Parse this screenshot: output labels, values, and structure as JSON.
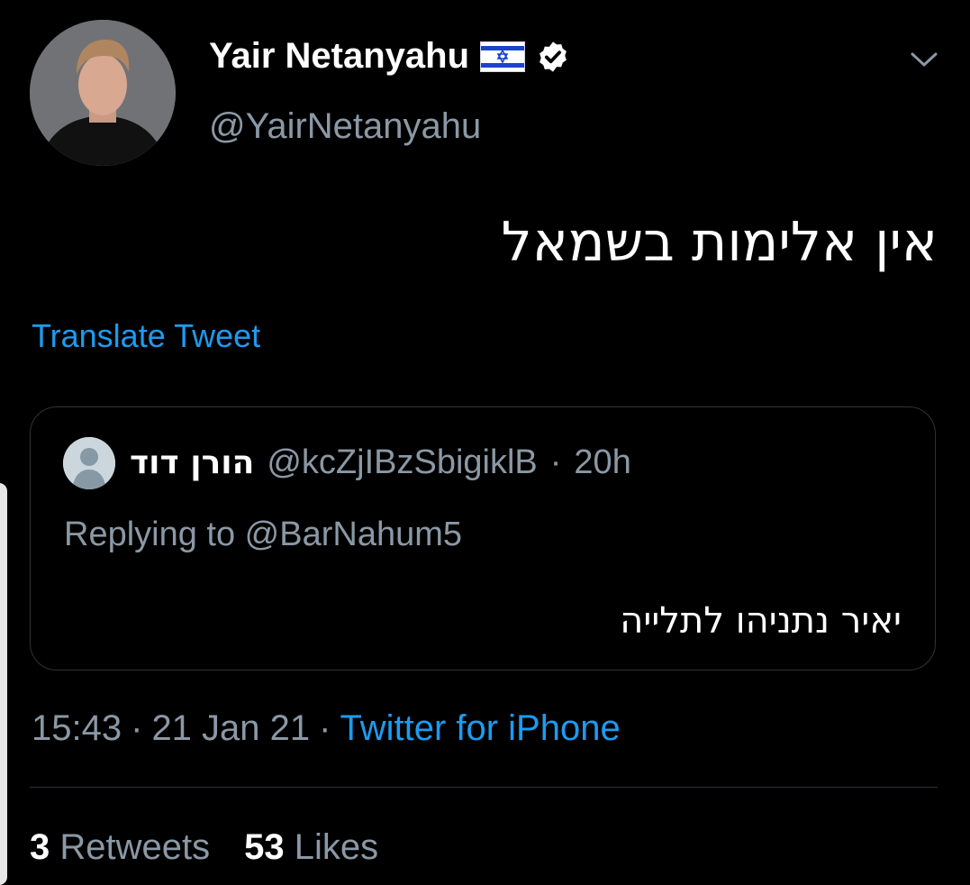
{
  "author": {
    "display_name": "Yair Netanyahu",
    "handle": "@YairNetanyahu",
    "flag_icon": "israel-flag-icon",
    "verified_icon": "verified-badge-icon"
  },
  "tweet": {
    "text": "אין אלימות בשמאל",
    "translate_label": "Translate Tweet"
  },
  "quoted_tweet": {
    "display_name": "הורן דוד",
    "handle": "@kcZjIBzSbigiklB",
    "separator": "·",
    "time": "20h",
    "replying_to": "Replying to @BarNahum5",
    "text": "יאיר נתניהו לתלייה"
  },
  "meta": {
    "time": "15:43",
    "sep1": "·",
    "date": "21 Jan 21",
    "sep2": "·",
    "source": "Twitter for iPhone"
  },
  "stats": {
    "retweets_count": "3",
    "retweets_label": "Retweets",
    "likes_count": "53",
    "likes_label": "Likes"
  },
  "colors": {
    "background": "#000000",
    "link": "#1d9bf0",
    "secondary_text": "#8b98a5",
    "border": "#2f3336"
  }
}
